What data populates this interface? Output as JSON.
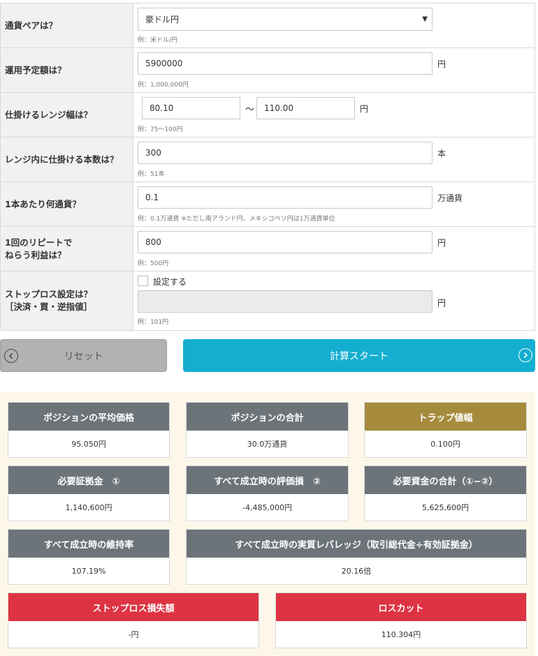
{
  "form": {
    "currency_pair": {
      "label": "通貨ペアは？",
      "value": "豪ドル円",
      "hint": "例：米ドル/円"
    },
    "budget": {
      "label": "運用予定額は？",
      "value": "5900000",
      "unit": "円",
      "hint": "例：1,000,000円"
    },
    "range": {
      "label": "仕掛けるレンジ幅は？",
      "low": "80.10",
      "tilde": "〜",
      "high": "110.00",
      "unit": "円",
      "hint": "例：75〜100円"
    },
    "count": {
      "label": "レンジ内に仕掛ける本数は？",
      "value": "300",
      "unit": "本",
      "hint": "例：51本"
    },
    "per_trap": {
      "label": "1本あたり何通貨？",
      "value": "0.1",
      "unit": "万通貨",
      "hint": "例：0.1万通貨 ※ただし南アランド円、メキシコペソ円は1万通貨単位"
    },
    "profit": {
      "label_line1": "1回のリピートで",
      "label_line2": "ねらう利益は？",
      "value": "800",
      "unit": "円",
      "hint": "例：500円"
    },
    "stoploss": {
      "label_line1": "ストップロス設定は？",
      "label_line2": "［決済・買・逆指値］",
      "checkbox_label": "設定する",
      "value": "",
      "unit": "円",
      "hint": "例：101円"
    }
  },
  "buttons": {
    "reset": "リセット",
    "start": "計算スタート"
  },
  "results": {
    "avg_price": {
      "title": "ポジションの平均価格",
      "value": "95.050円"
    },
    "total_position": {
      "title": "ポジションの合計",
      "value": "30.0万通貨"
    },
    "trap_width": {
      "title": "トラップ値幅",
      "value": "0.100円"
    },
    "margin": {
      "title": "必要証拠金　①",
      "value": "1,140,600円"
    },
    "eval_loss": {
      "title": "すべて成立時の評価損　②",
      "value": "-4,485,000円"
    },
    "total_funds": {
      "title": "必要資金の合計（①−②）",
      "value": "5,625,600円"
    },
    "maintenance": {
      "title": "すべて成立時の維持率",
      "value": "107.19%"
    },
    "leverage": {
      "title": "すべて成立時の実質レバレッジ（取引総代金÷有効証拠金）",
      "value": "20.16倍"
    },
    "stoploss_amount": {
      "title": "ストップロス損失額",
      "value": "-円"
    },
    "losscut": {
      "title": "ロスカット",
      "value": "110.304円"
    }
  },
  "colors": {
    "accent": "#14aed0",
    "header_gray": "#6c747a",
    "header_gold": "#a68b3d",
    "header_red": "#dd3343",
    "result_bg": "#fdf7ea"
  }
}
